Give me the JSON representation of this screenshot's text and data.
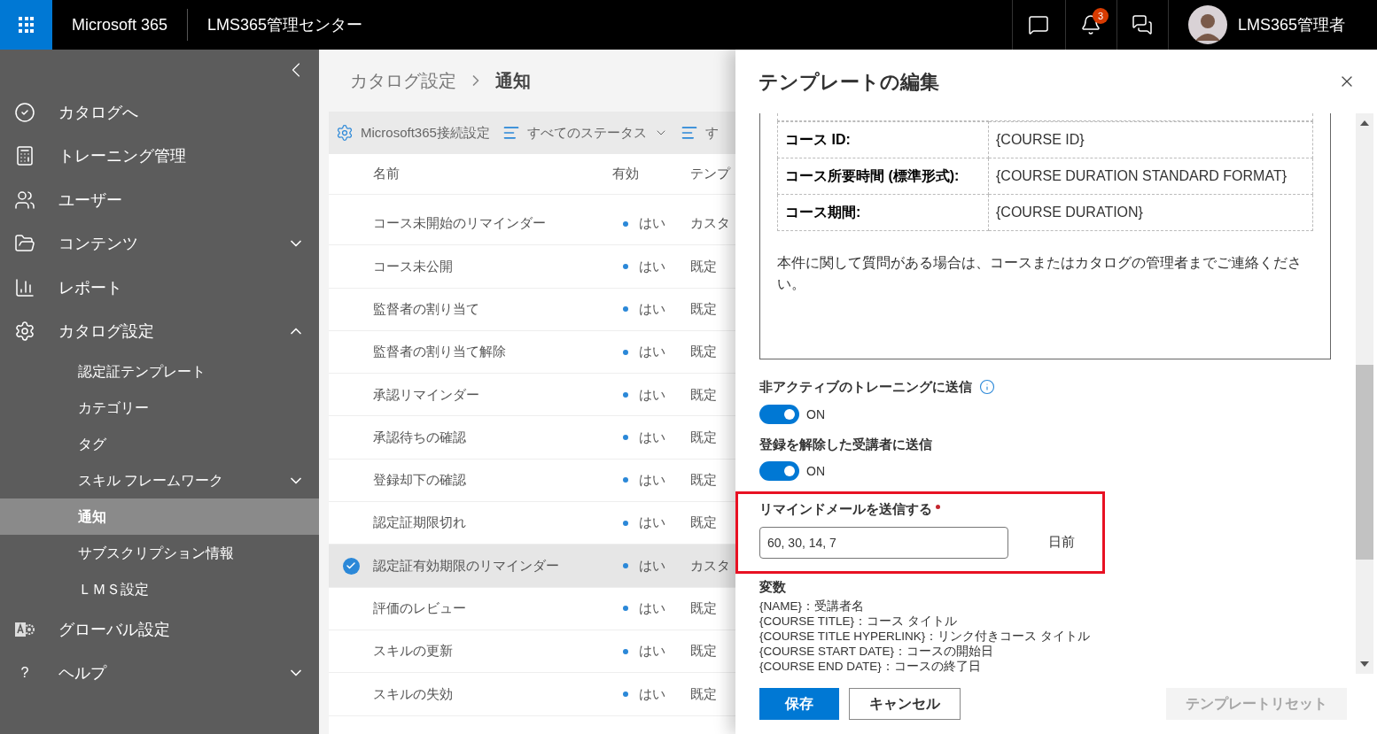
{
  "header": {
    "app_name": "Microsoft 365",
    "title": "LMS365管理センター",
    "notification_count": "3",
    "user_name": "LMS365管理者"
  },
  "sidebar": {
    "items": [
      {
        "label": "カタログへ",
        "selected": false
      },
      {
        "label": "トレーニング管理",
        "selected": false
      },
      {
        "label": "ユーザー",
        "selected": false
      },
      {
        "label": "コンテンツ",
        "expanded": false,
        "selected": false
      },
      {
        "label": "レポート",
        "selected": false
      },
      {
        "label": "カタログ設定",
        "expanded": true,
        "selected": false,
        "children": [
          {
            "label": "認定証テンプレート",
            "selected": false
          },
          {
            "label": "カテゴリー",
            "selected": false
          },
          {
            "label": "タグ",
            "selected": false
          },
          {
            "label": "スキル フレームワーク",
            "expanded": false,
            "selected": false
          },
          {
            "label": "通知",
            "selected": true
          },
          {
            "label": "サブスクリプション情報",
            "selected": false
          },
          {
            "label": "ＬＭＳ設定",
            "selected": false
          }
        ]
      },
      {
        "label": "グローバル設定",
        "selected": false
      },
      {
        "label": "ヘルプ",
        "icon_text": "?",
        "expanded": false,
        "selected": false
      }
    ]
  },
  "breadcrumb": [
    "カタログ設定",
    "通知"
  ],
  "toolbar": [
    {
      "kind": "settings",
      "label": "Microsoft365接続設定"
    },
    {
      "kind": "filter",
      "label": "すべてのステータス"
    },
    {
      "kind": "filter-cut",
      "label": "す"
    }
  ],
  "table": {
    "columns": [
      "名前",
      "有効",
      "テンプ"
    ],
    "rows": [
      {
        "name": "コース未開始のリマインダー",
        "enabled": "はい",
        "template": "カスタ",
        "selected": false
      },
      {
        "name": "コース未公開",
        "enabled": "はい",
        "template": "既定",
        "selected": false
      },
      {
        "name": "監督者の割り当て",
        "enabled": "はい",
        "template": "既定",
        "selected": false
      },
      {
        "name": "監督者の割り当て解除",
        "enabled": "はい",
        "template": "既定",
        "selected": false
      },
      {
        "name": "承認リマインダー",
        "enabled": "はい",
        "template": "既定",
        "selected": false
      },
      {
        "name": "承認待ちの確認",
        "enabled": "はい",
        "template": "既定",
        "selected": false
      },
      {
        "name": "登録却下の確認",
        "enabled": "はい",
        "template": "既定",
        "selected": false
      },
      {
        "name": "認定証期限切れ",
        "enabled": "はい",
        "template": "既定",
        "selected": false
      },
      {
        "name": "認定証有効期限のリマインダー",
        "enabled": "はい",
        "template": "カスタ",
        "selected": true
      },
      {
        "name": "評価のレビュー",
        "enabled": "はい",
        "template": "既定",
        "selected": false
      },
      {
        "name": "スキルの更新",
        "enabled": "はい",
        "template": "既定",
        "selected": false
      },
      {
        "name": "スキルの失効",
        "enabled": "はい",
        "template": "既定",
        "selected": false
      }
    ]
  },
  "panel": {
    "title": "テンプレートの編集",
    "editor": {
      "table": [
        {
          "label": "コース ID:",
          "value": "{COURSE ID}"
        },
        {
          "label": "コース所要時間 (標準形式):",
          "value": "{COURSE DURATION STANDARD FORMAT}"
        },
        {
          "label": "コース期間:",
          "value": "{COURSE DURATION}"
        }
      ],
      "paragraph": "本件に関して質問がある場合は、コースまたはカタログの管理者までご連絡ください。"
    },
    "toggles": [
      {
        "label": "非アクティブのトレーニングに送信",
        "info": true,
        "on": true,
        "state_text": "ON"
      },
      {
        "label": "登録を解除した受講者に送信",
        "info": false,
        "on": true,
        "state_text": "ON"
      }
    ],
    "reminder": {
      "label": "リマインドメールを送信する",
      "required": true,
      "value": "60, 30, 14, 7",
      "suffix": "日前"
    },
    "variables": {
      "title": "変数",
      "lines": [
        "{NAME}：受講者名",
        "{COURSE TITLE}：コース タイトル",
        "{COURSE TITLE HYPERLINK}：リンク付きコース タイトル",
        "{COURSE START DATE}：コースの開始日",
        "{COURSE END DATE}：コースの終了日"
      ]
    },
    "buttons": [
      {
        "kind": "primary",
        "label": "保存",
        "disabled": false
      },
      {
        "kind": "secondary",
        "label": "キャンセル",
        "disabled": false
      },
      {
        "kind": "reset",
        "label": "テンプレートリセット",
        "disabled": true
      }
    ]
  }
}
